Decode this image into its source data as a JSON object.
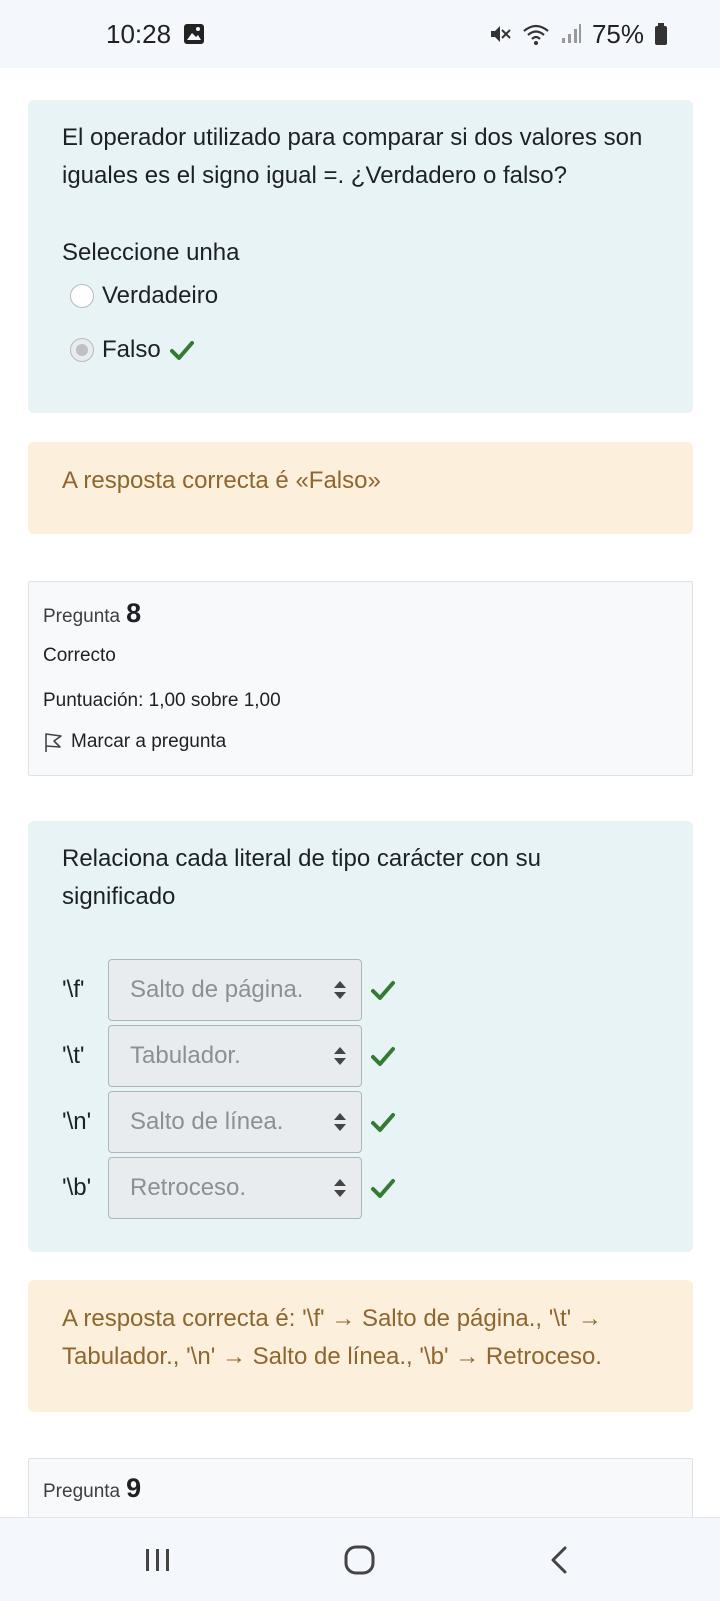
{
  "status_bar": {
    "time": "10:28",
    "battery": "75%"
  },
  "q7": {
    "question": "El operador utilizado para comparar si dos valores son iguales es el signo igual =. ¿Verdadero o falso?",
    "prompt": "Seleccione unha",
    "options": [
      {
        "label": "Verdadeiro",
        "selected": false
      },
      {
        "label": "Falso",
        "selected": true,
        "correct": true
      }
    ],
    "feedback": "A resposta correcta é «Falso»"
  },
  "q8": {
    "info": {
      "title_prefix": "Pregunta",
      "number": "8",
      "state": "Correcto",
      "grade": "Puntuación: 1,00 sobre 1,00",
      "flag_label": "Marcar a pregunta"
    },
    "question": "Relaciona cada literal de tipo carácter con su significado",
    "rows": [
      {
        "literal": "'\\f'",
        "answer": "Salto de página."
      },
      {
        "literal": "'\\t'",
        "answer": "Tabulador."
      },
      {
        "literal": "'\\n'",
        "answer": "Salto de línea."
      },
      {
        "literal": "'\\b'",
        "answer": "Retroceso."
      }
    ],
    "feedback": "A resposta correcta é: '\\f' → Salto de página., '\\t' → Tabulador., '\\n' → Salto de línea., '\\b' → Retroceso."
  },
  "q9": {
    "info": {
      "title_prefix": "Pregunta",
      "number": "9"
    }
  },
  "colors": {
    "check": "#357a32",
    "feedback_text": "#8e662e",
    "qtext_bg": "#e7f3f5",
    "feedback_bg": "#fcefdc"
  },
  "icons": {
    "status": [
      "gallery-icon",
      "mute-icon",
      "wifi-icon",
      "signal-icon",
      "battery-icon"
    ],
    "nav": [
      "recent-apps-icon",
      "home-icon",
      "back-icon"
    ]
  }
}
